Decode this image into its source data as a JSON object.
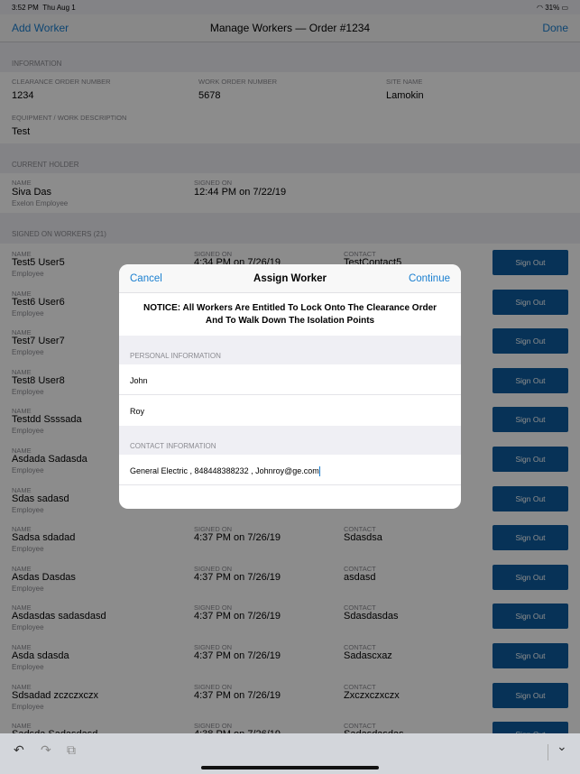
{
  "status": {
    "time": "3:52 PM",
    "date": "Thu Aug 1",
    "battery": "31%"
  },
  "nav": {
    "left": "Add Worker",
    "title": "Manage Workers — Order #1234",
    "right": "Done"
  },
  "info": {
    "header": "INFORMATION",
    "clearance_label": "CLEARANCE ORDER NUMBER",
    "clearance": "1234",
    "work_label": "WORK ORDER NUMBER",
    "work": "5678",
    "site_label": "SITE NAME",
    "site": "Lamokin",
    "equip_label": "EQUIPMENT / WORK DESCRIPTION",
    "equip": "Test"
  },
  "holder": {
    "header": "CURRENT HOLDER",
    "name_label": "NAME",
    "name": "Siva Das",
    "role": "Exelon Employee",
    "signed_label": "SIGNED ON",
    "signed": "12:44 PM on 7/22/19"
  },
  "workers": {
    "header": "SIGNED ON WORKERS (21)",
    "name_label": "NAME",
    "signed_label": "SIGNED ON",
    "contact_label": "CONTACT",
    "button": "Sign Out",
    "rows": [
      {
        "name": "Test5 User5",
        "role": "Employee",
        "signed": "4:34 PM on 7/26/19",
        "contact": "TestContact5"
      },
      {
        "name": "Test6 User6",
        "role": "Employee"
      },
      {
        "name": "Test7 User7",
        "role": "Employee"
      },
      {
        "name": "Test8 User8",
        "role": "Employee"
      },
      {
        "name": "Testdd Ssssada",
        "role": "Employee"
      },
      {
        "name": "Asdada Sadasda",
        "role": "Employee"
      },
      {
        "name": "Sdas sadasd",
        "role": "Employee"
      },
      {
        "name": "Sadsa sdadad",
        "role": "Employee",
        "signed": "4:37 PM on 7/26/19",
        "contact": "Sdasdsa"
      },
      {
        "name": "Asdas Dasdas",
        "role": "Employee",
        "signed": "4:37 PM on 7/26/19",
        "contact": "asdasd"
      },
      {
        "name": "Asdasdas sadasdasd",
        "role": "Employee",
        "signed": "4:37 PM on 7/26/19",
        "contact": "Sdasdasdas"
      },
      {
        "name": "Asda sdasda",
        "role": "Employee",
        "signed": "4:37 PM on 7/26/19",
        "contact": "Sadascxaz"
      },
      {
        "name": "Sdsadad zczczxczx",
        "role": "Employee",
        "signed": "4:37 PM on 7/26/19",
        "contact": "Zxczxczxczx"
      },
      {
        "name": "Sadsda Sadasdasd",
        "role": "",
        "signed": "4:38 PM on 7/26/19",
        "contact": "Sadasdasdas"
      }
    ]
  },
  "modal": {
    "cancel": "Cancel",
    "title": "Assign Worker",
    "continue": "Continue",
    "notice_1": "NOTICE: All Workers Are Entitled To Lock Onto The Clearance Order",
    "notice_2": "And To Walk Down The Isolation Points",
    "personal_header": "PERSONAL INFORMATION",
    "first_name": "John",
    "last_name": "Roy",
    "contact_header": "CONTACT INFORMATION",
    "contact": "General Electric , 848448388232 , Johnroy@ge.com",
    "extra": ""
  },
  "toolbar": {
    "undo": "↶",
    "redo": "↷",
    "paste": "⧉",
    "hide": "⌄"
  }
}
